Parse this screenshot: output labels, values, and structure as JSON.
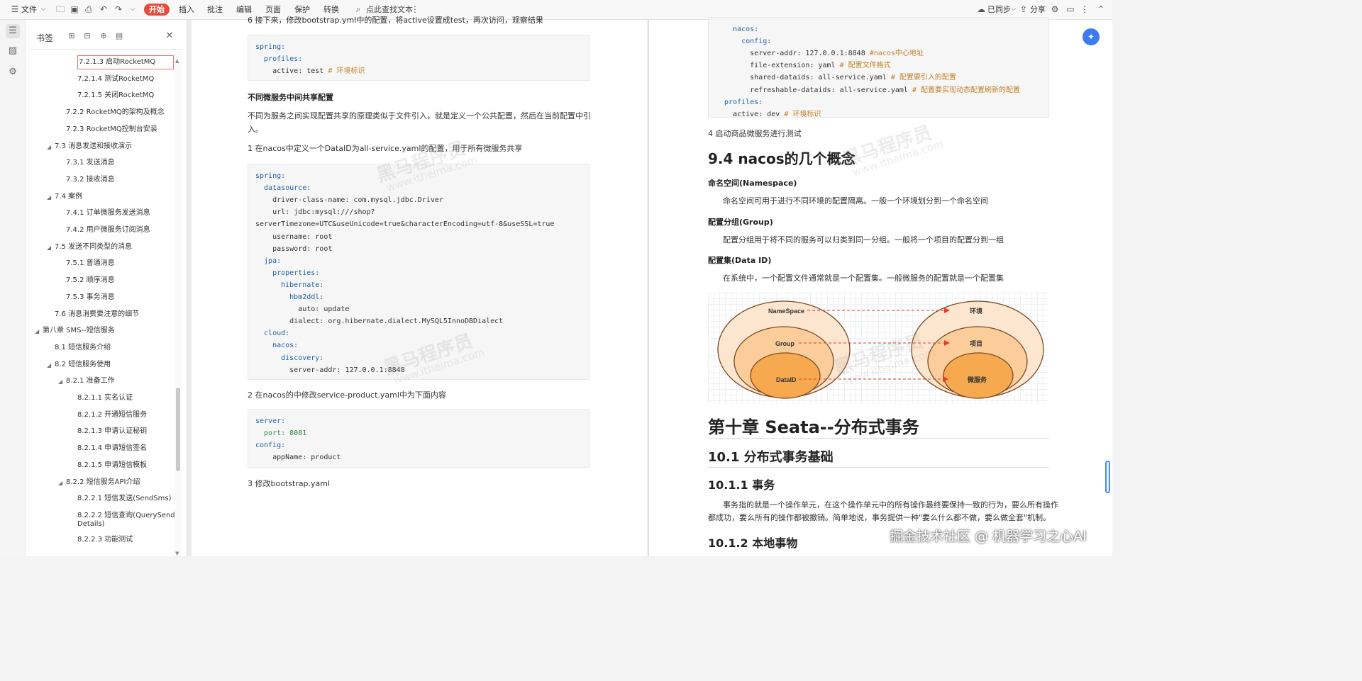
{
  "toolbar": {
    "file_label": "文件",
    "start_label": "开始",
    "menu": [
      "插入",
      "批注",
      "编辑",
      "页面",
      "保护",
      "转换"
    ],
    "search_label": "点此查找文本",
    "sync_label": "已同步",
    "share_label": "分享"
  },
  "bookmarks": {
    "title": "书签",
    "items": [
      {
        "label": "7.2.1.3 启动RocketMQ",
        "level": 3,
        "selected": true
      },
      {
        "label": "7.2.1.4 测试RocketMQ",
        "level": 3
      },
      {
        "label": "7.2.1.5 关闭RocketMQ",
        "level": 3
      },
      {
        "label": "7.2.2 RocketMQ的架构及概念",
        "level": 2
      },
      {
        "label": "7.2.3 RocketMQ控制台安装",
        "level": 2
      },
      {
        "label": "7.3 消息发送和接收演示",
        "level": 1,
        "expanded": true
      },
      {
        "label": "7.3.1 发送消息",
        "level": 2
      },
      {
        "label": "7.3.2 接收消息",
        "level": 2
      },
      {
        "label": "7.4 案例",
        "level": 1,
        "expanded": true
      },
      {
        "label": "7.4.1 订单微服务发送消息",
        "level": 2
      },
      {
        "label": "7.4.2 用户微服务订阅消息",
        "level": 2
      },
      {
        "label": "7.5 发送不同类型的消息",
        "level": 1,
        "expanded": true
      },
      {
        "label": "7.5.1 普通消息",
        "level": 2
      },
      {
        "label": "7.5.2 顺序消息",
        "level": 2
      },
      {
        "label": "7.5.3 事务消息",
        "level": 2
      },
      {
        "label": "7.6 消息消费要注意的细节",
        "level": 1
      },
      {
        "label": "第八章 SMS--短信服务",
        "level": 0,
        "expanded": true
      },
      {
        "label": "8.1 短信服务介绍",
        "level": 1
      },
      {
        "label": "8.2 短信服务使用",
        "level": 1,
        "expanded": true
      },
      {
        "label": "8.2.1 准备工作",
        "level": 2,
        "expanded": true
      },
      {
        "label": "8.2.1.1 实名认证",
        "level": 3
      },
      {
        "label": "8.2.1.2 开通短信服务",
        "level": 3
      },
      {
        "label": "8.2.1.3 申请认证秘钥",
        "level": 3
      },
      {
        "label": "8.2.1.4 申请短信签名",
        "level": 3
      },
      {
        "label": "8.2.1.5 申请短信模板",
        "level": 3
      },
      {
        "label": "8.2.2 短信服务API介绍",
        "level": 2,
        "expanded": true
      },
      {
        "label": "8.2.2.1 短信发送(SendSms)",
        "level": 3
      },
      {
        "label": "8.2.2.2 短信查询(QuerySend",
        "label2": "Details)",
        "level": 3
      },
      {
        "label": "8.2.2.3 功能测试",
        "level": 3
      }
    ]
  },
  "page1": {
    "top_partial": "6 接下来，修改bootstrap.yml中的配置，将active设置成test，再次访问，观察结果",
    "code1": [
      "spring:",
      "  profiles:",
      "    active: test # 环境标识"
    ],
    "heading_shared": "不同微服务中间共享配置",
    "para_shared_1": "不同为服务之间实现配置共享的原理类似于文件引入，就是定义一个公共配置，然后在当前配置中引",
    "para_shared_2": "入。",
    "step1": "1 在nacos中定义一个DataID为all-service.yaml的配置，用于所有微服务共享",
    "code2": [
      "spring:",
      "  datasource:",
      "    driver-class-name: com.mysql.jdbc.Driver",
      "    url: jdbc:mysql:///shop?",
      "serverTimezone=UTC&useUnicode=true&characterEncoding=utf-8&useSSL=true",
      "    username: root",
      "    password: root",
      "  jpa:",
      "    properties:",
      "      hibernate:",
      "        hbm2ddl:",
      "          auto: update",
      "        dialect: org.hibernate.dialect.MySQL5InnoDBDialect",
      "  cloud:",
      "    nacos:",
      "      discovery:",
      "        server-addr: 127.0.0.1:8848"
    ],
    "step2": "2 在nacos的中修改service-product.yaml中为下面内容",
    "code3": [
      "server:",
      "  port: 8081",
      "config:",
      "    appName: product"
    ],
    "step3": "3 修改bootstrap.yaml"
  },
  "page2": {
    "code_top": [
      "    nacos:",
      "      config:",
      "        server-addr: 127.0.0.1:8848 #nacos中心地址",
      "        file-extension: yaml # 配置文件格式",
      "        shared-dataids: all-service.yaml # 配置要引入的配置",
      "        refreshable-dataids: all-service.yaml # 配置要实现动态配置刷新的配置",
      "  profiles:",
      "    active: dev # 环境标识"
    ],
    "step4": "4 启动商品微服务进行测试",
    "h_concepts": "9.4 nacos的几个概念",
    "ns_title": "命名空间(Namespace)",
    "ns_text": "命名空间可用于进行不同环境的配置隔离。一般一个环境划分到一个命名空间",
    "group_title": "配置分组(Group)",
    "group_text": "配置分组用于将不同的服务可以归类到同一分组。一般将一个项目的配置分到一组",
    "dataid_title": "配置集(Data ID)",
    "dataid_text": "在系统中，一个配置文件通常就是一个配置集。一般微服务的配置就是一个配置集",
    "diagram": {
      "left_labels": [
        "NameSpace",
        "Group",
        "DataID"
      ],
      "right_labels": [
        "环境",
        "项目",
        "微服务"
      ]
    },
    "chapter10": "第十章 Seata--分布式事务",
    "h10_1": "10.1 分布式事务基础",
    "h10_1_1": "10.1.1 事务",
    "tx_text_1": "事务指的就是一个操作单元，在这个操作单元中的所有操作最终要保持一致的行为，要么所有操作",
    "tx_text_2": "都成功，要么所有的操作都被撤销。简单地说，事务提供一种\"要么什么都不做，要么做全套\"机制。",
    "h10_1_2": "10.1.2 本地事物"
  },
  "watermark": {
    "cn": "黑马程序员",
    "url": "www.itheima.com"
  },
  "footer_watermark": "掘金技术社区 @ 机器学习之心AI"
}
